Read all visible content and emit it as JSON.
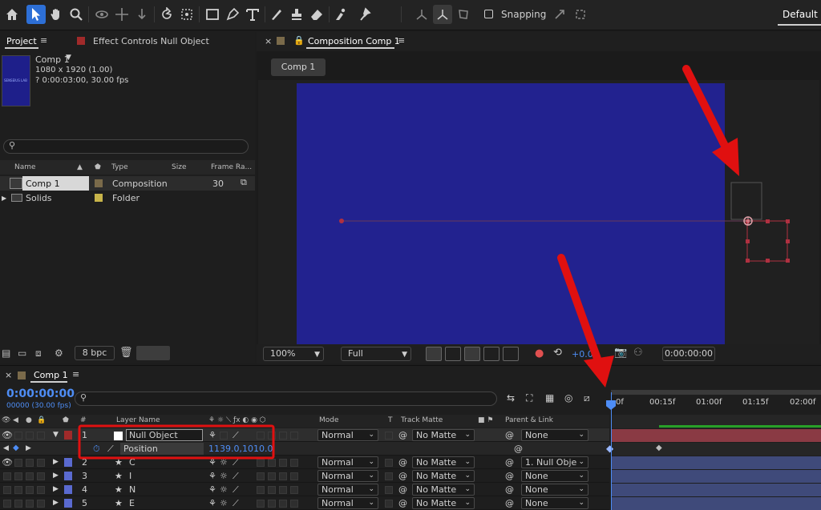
{
  "toolbar": {
    "tools": [
      "home-icon",
      "selection-tool-icon",
      "hand-tool-icon",
      "zoom-tool-icon",
      "orbit-camera-icon",
      "pan-camera-icon",
      "dolly-camera-icon",
      "rotation-tool-icon",
      "pan-behind-icon",
      "rectangle-tool-icon",
      "pen-tool-icon",
      "type-tool-icon",
      "brush-tool-icon",
      "clone-stamp-icon",
      "eraser-tool-icon",
      "roto-brush-icon",
      "puppet-pin-icon"
    ],
    "snapping_label": "Snapping",
    "workspace_label": "Default"
  },
  "project_panel": {
    "tab_label": "Project",
    "effect_controls_label": "Effect Controls Null Object",
    "item_name": "Comp 1",
    "item_dims": "1080 x 1920 (1.00)",
    "item_duration": "? 0:00:03:00, 30.00 fps",
    "thumb_text": "SENSEIUS LAB",
    "columns": {
      "name": "Name",
      "type": "Type",
      "size": "Size",
      "frame_rate": "Frame Ra..."
    },
    "items": [
      {
        "name": "Comp 1",
        "type": "Composition",
        "frame_rate": "30",
        "color": "#7a6a4a"
      },
      {
        "name": "Solids",
        "type": "Folder",
        "frame_rate": "",
        "color": "#c8b44a"
      }
    ],
    "bpc_label": "8 bpc"
  },
  "viewer": {
    "tab_label": "Composition Comp 1",
    "comp_chip": "Comp 1",
    "zoom": "100%",
    "resolution": "Full",
    "exposure": "+0.0",
    "timecode": "0:00:00:00",
    "comp_color": "#22228f"
  },
  "timeline": {
    "tab_label": "Comp 1",
    "current_time": "0:00:00:00",
    "fps": "00000 (30.00 fps)",
    "headers": {
      "num": "#",
      "layer_name": "Layer Name",
      "mode": "Mode",
      "t": "T",
      "track_matte": "Track Matte",
      "parent": "Parent & Link"
    },
    "ruler_ticks": [
      "0f",
      "00:15f",
      "01:00f",
      "01:15f",
      "02:00f"
    ],
    "layers": [
      {
        "num": "1",
        "name": "Null Object",
        "mode": "Normal",
        "matte": "No Matte",
        "parent": "None",
        "color": "#ffffff",
        "selected": true,
        "icon": "none"
      },
      {
        "num": "2",
        "name": "C",
        "mode": "Normal",
        "matte": "No Matte",
        "parent": "1. Null Obje",
        "color": "#5a6ad0",
        "selected": false,
        "icon": "star"
      },
      {
        "num": "3",
        "name": "I",
        "mode": "Normal",
        "matte": "No Matte",
        "parent": "None",
        "color": "#5a6ad0",
        "selected": false,
        "icon": "star"
      },
      {
        "num": "4",
        "name": "N",
        "mode": "Normal",
        "matte": "No Matte",
        "parent": "None",
        "color": "#5a6ad0",
        "selected": false,
        "icon": "star"
      },
      {
        "num": "5",
        "name": "E",
        "mode": "Normal",
        "matte": "No Matte",
        "parent": "None",
        "color": "#5a6ad0",
        "selected": false,
        "icon": "star"
      }
    ],
    "property": {
      "name": "Position",
      "value": "1139.0,1010.0"
    }
  },
  "colors": {
    "accent": "#4e8df5",
    "annotation_red": "#e01010",
    "layer_bar_selected": "#8a3a44",
    "layer_bar": "#3f4a7a"
  }
}
